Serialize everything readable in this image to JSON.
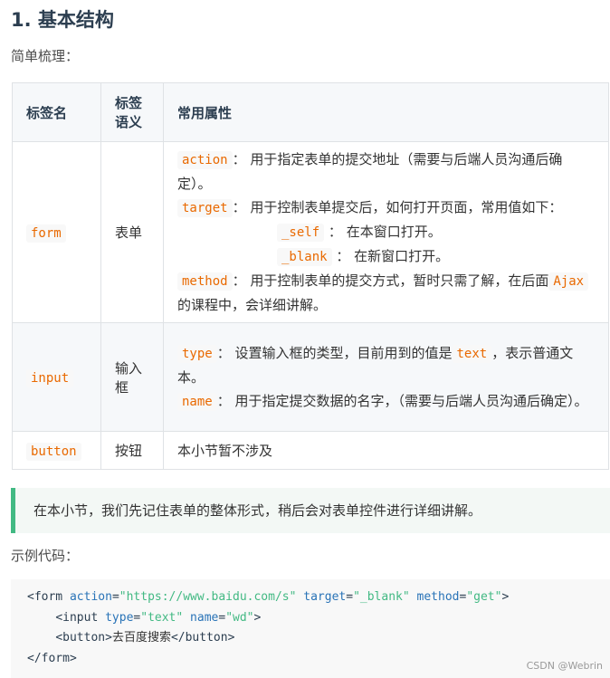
{
  "heading": "1. 基本结构",
  "intro": "简单梳理：",
  "table": {
    "headers": [
      "标签名",
      "标签语义",
      "常用属性"
    ],
    "rows": [
      {
        "tag": "form",
        "semantic": "表单",
        "attrs": {
          "action_code": "action",
          "action_desc": "： 用于指定表单的提交地址（需要与后端人员沟通后确定）。",
          "target_code": "target",
          "target_desc": "： 用于控制表单提交后，如何打开页面，常用值如下：",
          "self_code": "_self",
          "self_desc": " ： 在本窗口打开。",
          "blank_code": "_blank",
          "blank_desc": " ： 在新窗口打开。",
          "method_code": "method",
          "method_desc": "： 用于控制表单的提交方式，暂时只需了解，在后面",
          "ajax_code": "Ajax",
          "ajax_desc": " 的课程中，会详细讲解。"
        }
      },
      {
        "tag": "input",
        "semantic": "输入框",
        "attrs": {
          "type_code": "type",
          "type_desc": "： 设置输入框的类型，目前用到的值是",
          "text_code": "text",
          "type_desc2": "，表示普通文本。",
          "name_code": "name",
          "name_desc": "： 用于指定提交数据的名字，（需要与后端人员沟通后确定）。"
        }
      },
      {
        "tag": "button",
        "semantic": "按钮",
        "attrs_text": "本小节暂不涉及"
      }
    ]
  },
  "tip": "在本小节，我们先记住表单的整体形式，稍后会对表单控件进行详细讲解。",
  "example_label": "示例代码：",
  "code": {
    "l1_open": "<form",
    "l1_attr1": "action",
    "l1_val1": "\"https://www.baidu.com/s\"",
    "l1_attr2": "target",
    "l1_val2": "\"_blank\"",
    "l1_attr3": "method",
    "l1_val3": "\"get\"",
    "l1_close": ">",
    "l2_open": "<input",
    "l2_attr1": "type",
    "l2_val1": "\"text\"",
    "l2_attr2": "name",
    "l2_val2": "\"wd\"",
    "l2_close": ">",
    "l3_open": "<button>",
    "l3_text": "去百度搜索",
    "l3_close": "</button>",
    "l4": "</form>"
  },
  "watermark": "CSDN @Webrin",
  "colors": {
    "accent_green": "#42b983",
    "code_orange": "#e96900",
    "border": "#dfe2e5"
  }
}
